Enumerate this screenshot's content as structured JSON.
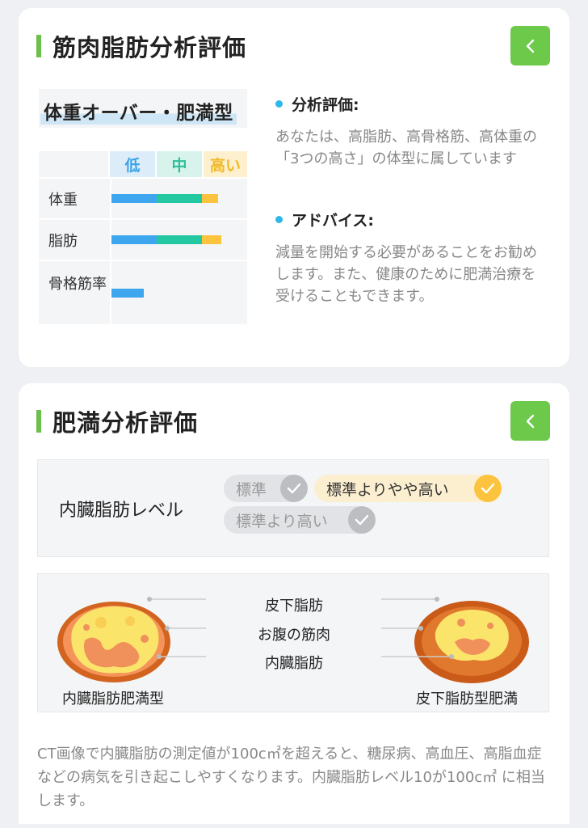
{
  "muscle_fat_section": {
    "title": "筋肉脂肪分析評価",
    "body_type": "体重オーバー・肥満型",
    "table": {
      "levels": [
        "低",
        "中",
        "高い"
      ],
      "rows": [
        {
          "label": "体重"
        },
        {
          "label": "脂肪"
        },
        {
          "label": "骨格筋率"
        }
      ]
    },
    "analysis": {
      "heading": "分析評価:",
      "text": "あなたは、高脂肪、高骨格筋、高体重の「3つの高さ」の体型に属しています"
    },
    "advice": {
      "heading": "アドバイス:",
      "text": "減量を開始する必要があることをお勧めします。また、健康のために肥満治療を受けることもできます。"
    }
  },
  "obesity_section": {
    "title": "肥満分析評価",
    "visceral_fat": {
      "label": "内臓脂肪レベル",
      "options": [
        "標準",
        "標準よりやや高い",
        "標準より高い"
      ],
      "selected": "標準よりやや高い"
    },
    "ct_diagram": {
      "labels": [
        "皮下脂肪",
        "お腹の筋肉",
        "内臓脂肪"
      ],
      "left_caption": "内臓脂肪肥満型",
      "right_caption": "皮下脂肪型肥満"
    },
    "note": "CT画像で内臓脂肪の測定値が100c㎡を超えると、糖尿病、高血圧、高脂血症などの病気を引き起こしやすくなります。内臓脂肪レベル10が100c㎡ に相当します。"
  },
  "colors": {
    "accent_green": "#6cc94a",
    "level_low": "#3ea6ee",
    "level_mid": "#23c8a0",
    "level_high": "#fcc43e"
  },
  "icons": {
    "back": "chevron-left-icon",
    "check": "check-icon"
  }
}
